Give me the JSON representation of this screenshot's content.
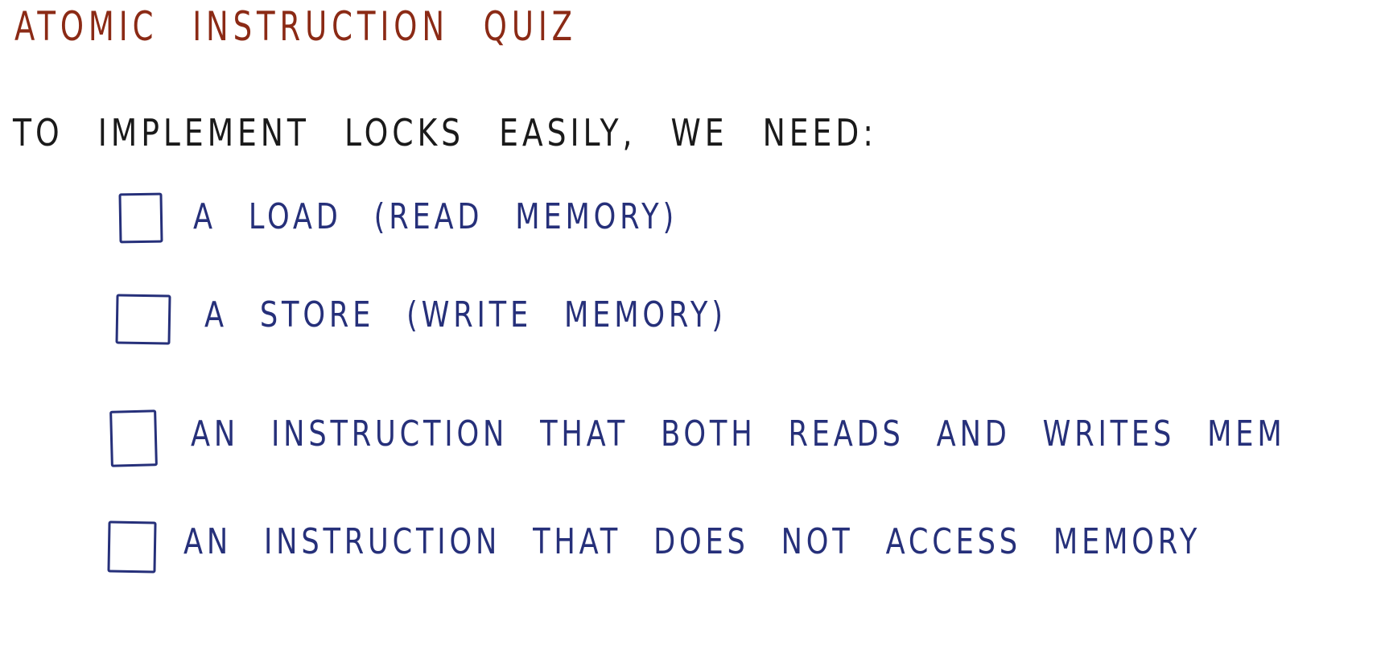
{
  "colors": {
    "title": "#8b2a15",
    "prompt": "#1a1a1a",
    "options": "#26307a",
    "background": "#ffffff"
  },
  "quiz": {
    "title": "ATOMIC  INSTRUCTION  QUIZ",
    "prompt": "TO IMPLEMENT LOCKS EASILY, WE NEED:",
    "options": [
      {
        "label": "A LOAD (READ MEMORY)",
        "checked": false
      },
      {
        "label": "A STORE (WRITE MEMORY)",
        "checked": false
      },
      {
        "label": "AN INSTRUCTION THAT BOTH READS AND WRITES MEM",
        "checked": false
      },
      {
        "label": "AN INSTRUCTION THAT DOES NOT ACCESS MEMORY",
        "checked": false
      }
    ]
  }
}
